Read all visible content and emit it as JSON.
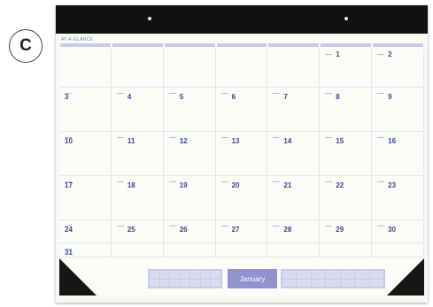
{
  "badge": {
    "letter": "C"
  },
  "calendar": {
    "brand_text": "AT-A-GLANCE",
    "month_label": "January",
    "weeks": [
      [
        "",
        "",
        "",
        "",
        "",
        "1",
        "2"
      ],
      [
        "3",
        "4",
        "5",
        "6",
        "7",
        "8",
        "9"
      ],
      [
        "10",
        "11",
        "12",
        "13",
        "14",
        "15",
        "16"
      ],
      [
        "17",
        "18",
        "19",
        "20",
        "21",
        "22",
        "23"
      ],
      [
        "24",
        "25",
        "26",
        "27",
        "28",
        "29",
        "30"
      ],
      [
        "31",
        "",
        "",
        "",
        "",
        "",
        ""
      ]
    ]
  },
  "colors": {
    "header": "#111111",
    "accent": "#3b4596",
    "dow_band": "#c9cbe6",
    "month_tab": "#8f93cf"
  }
}
